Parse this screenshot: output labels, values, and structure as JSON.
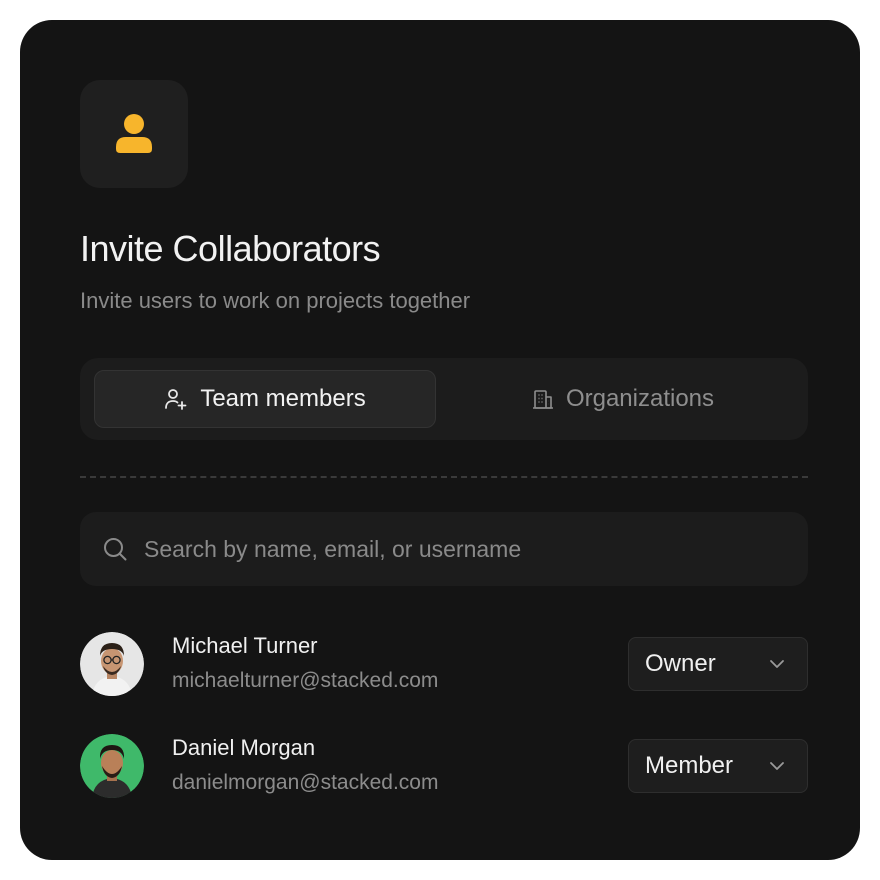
{
  "header": {
    "icon": "user-icon",
    "title": "Invite Collaborators",
    "subtitle": "Invite users to work on projects together"
  },
  "tabs": [
    {
      "label": "Team members",
      "icon": "user-plus-icon",
      "active": true
    },
    {
      "label": "Organizations",
      "icon": "building-icon",
      "active": false
    }
  ],
  "search": {
    "placeholder": "Search by name, email, or username",
    "value": ""
  },
  "users": [
    {
      "name": "Michael Turner",
      "email": "michaelturner@stacked.com",
      "role": "Owner",
      "avatar_bg": "#e6e6e6"
    },
    {
      "name": "Daniel Morgan",
      "email": "danielmorgan@stacked.com",
      "role": "Member",
      "avatar_bg": "#3fb96a"
    }
  ],
  "colors": {
    "accent": "#f7b52c",
    "card_bg": "#141414"
  }
}
